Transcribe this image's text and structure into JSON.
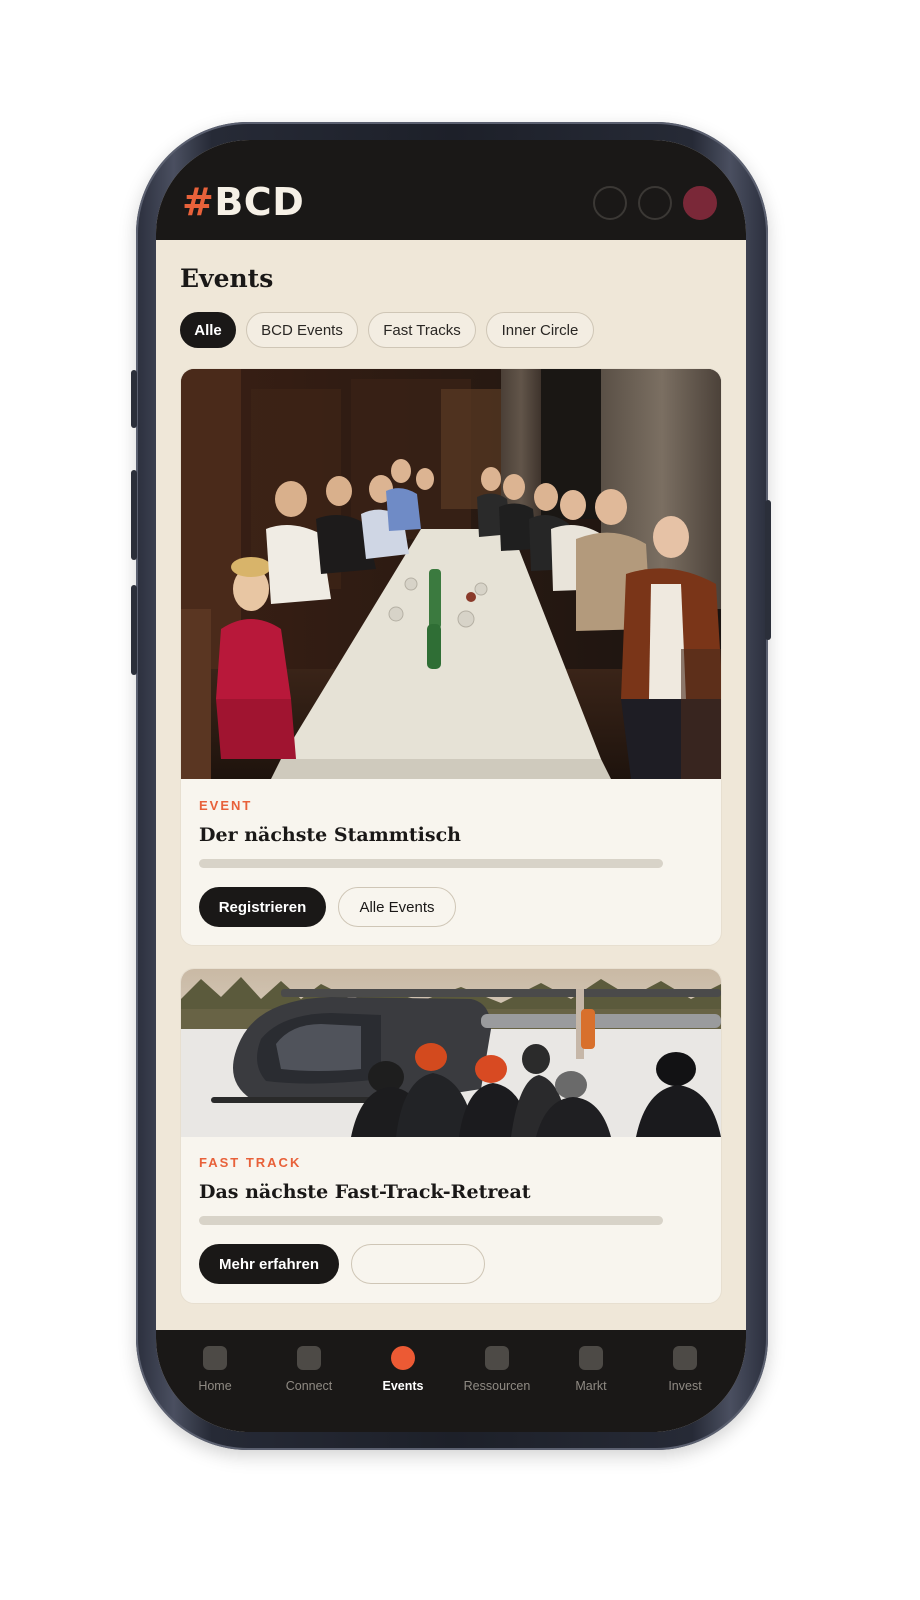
{
  "app": {
    "logo_hash": "#",
    "logo_text": "BCD"
  },
  "page": {
    "title": "Events"
  },
  "filters": [
    {
      "label": "Alle",
      "active": true
    },
    {
      "label": "BCD Events",
      "active": false
    },
    {
      "label": "Fast Tracks",
      "active": false
    },
    {
      "label": "Inner Circle",
      "active": false
    }
  ],
  "cards": [
    {
      "kicker": "EVENT",
      "title": "Der nächste Stammtisch",
      "primary_button": "Registrieren",
      "secondary_button": "Alle Events"
    },
    {
      "kicker": "FAST TRACK",
      "title": "Das nächste Fast-Track-Retreat",
      "primary_button": "Mehr erfahren",
      "secondary_button": ""
    }
  ],
  "bottom_nav": [
    {
      "label": "Home",
      "active": false
    },
    {
      "label": "Connect",
      "active": false
    },
    {
      "label": "Events",
      "active": true
    },
    {
      "label": "Ressourcen",
      "active": false
    },
    {
      "label": "Markt",
      "active": false
    },
    {
      "label": "Invest",
      "active": false
    }
  ],
  "colors": {
    "accent": "#e8613a",
    "dark": "#1a1817",
    "background": "#efe7d8",
    "card": "#f8f5ee",
    "avatar": "#7a2838"
  }
}
